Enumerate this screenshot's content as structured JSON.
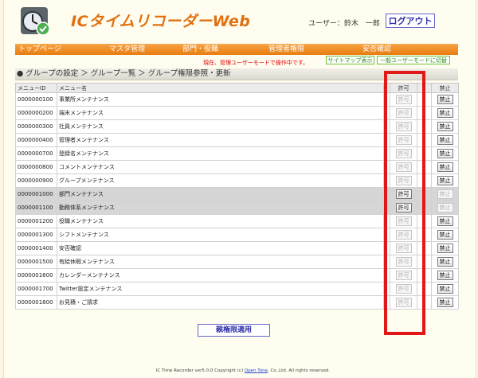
{
  "header": {
    "app_title": "ICタイムリコーダーWeb",
    "user_label": "ユーザー：鈴木　一郎",
    "logout_label": "ログアウト"
  },
  "nav": {
    "items": [
      "トップページ",
      "マスタ管理",
      "部門・役職",
      "管理者権限",
      "安否確認"
    ]
  },
  "mode": {
    "notice": "現在、管理ユーザーモードで操作中です。",
    "sitemap_label": "サイトマップ表示",
    "switch_label": "一般ユーザーモードに切替"
  },
  "breadcrumb": "● グループの設定 ＞ グループ一覧 ＞ グループ権限参照・更新",
  "table": {
    "headers": {
      "id": "メニューID",
      "name": "メニュー名",
      "allow": "許可",
      "deny": "禁止"
    },
    "rows": [
      {
        "id": "0000000100",
        "name": "事業所メンテナンス",
        "allow": "許可",
        "deny": "禁止",
        "state": "allowed"
      },
      {
        "id": "0000000200",
        "name": "端末メンテナンス",
        "allow": "許可",
        "deny": "禁止",
        "state": "allowed"
      },
      {
        "id": "0000000300",
        "name": "社員メンテナンス",
        "allow": "許可",
        "deny": "禁止",
        "state": "allowed"
      },
      {
        "id": "0000000400",
        "name": "管理者メンテナンス",
        "allow": "許可",
        "deny": "禁止",
        "state": "allowed"
      },
      {
        "id": "0000000700",
        "name": "登録名メンテナンス",
        "allow": "許可",
        "deny": "禁止",
        "state": "allowed"
      },
      {
        "id": "0000000800",
        "name": "コメントメンテナンス",
        "allow": "許可",
        "deny": "禁止",
        "state": "allowed"
      },
      {
        "id": "0000000900",
        "name": "グループメンテナンス",
        "allow": "許可",
        "deny": "禁止",
        "state": "allowed"
      },
      {
        "id": "0000001000",
        "name": "部門メンテナンス",
        "allow": "許可",
        "deny": "禁止",
        "state": "denied"
      },
      {
        "id": "0000001100",
        "name": "勤務体系メンテナンス",
        "allow": "許可",
        "deny": "禁止",
        "state": "denied"
      },
      {
        "id": "0000001200",
        "name": "役職メンテナンス",
        "allow": "許可",
        "deny": "禁止",
        "state": "allowed"
      },
      {
        "id": "0000001300",
        "name": "シフトメンテナンス",
        "allow": "許可",
        "deny": "禁止",
        "state": "allowed"
      },
      {
        "id": "0000001400",
        "name": "安否確認",
        "allow": "許可",
        "deny": "禁止",
        "state": "allowed"
      },
      {
        "id": "0000001500",
        "name": "有給休暇メンテナンス",
        "allow": "許可",
        "deny": "禁止",
        "state": "allowed"
      },
      {
        "id": "0000001600",
        "name": "カレンダーメンテナンス",
        "allow": "許可",
        "deny": "禁止",
        "state": "allowed"
      },
      {
        "id": "0000001700",
        "name": "Twitter設定メンテナンス",
        "allow": "許可",
        "deny": "禁止",
        "state": "allowed"
      },
      {
        "id": "0000001800",
        "name": "お見積・ご請求",
        "allow": "許可",
        "deny": "禁止",
        "state": "allowed"
      }
    ]
  },
  "apply_label": "親権限適用",
  "footer": {
    "prefix": "IC Time Recorder ver5.0.0 Copyright (c) ",
    "link": "Open Tone",
    "suffix": ", Co.,Ltd. All rights reserved."
  },
  "colors": {
    "accent": "#e77d10",
    "highlight": "#e01818",
    "button_text": "#3333aa"
  }
}
